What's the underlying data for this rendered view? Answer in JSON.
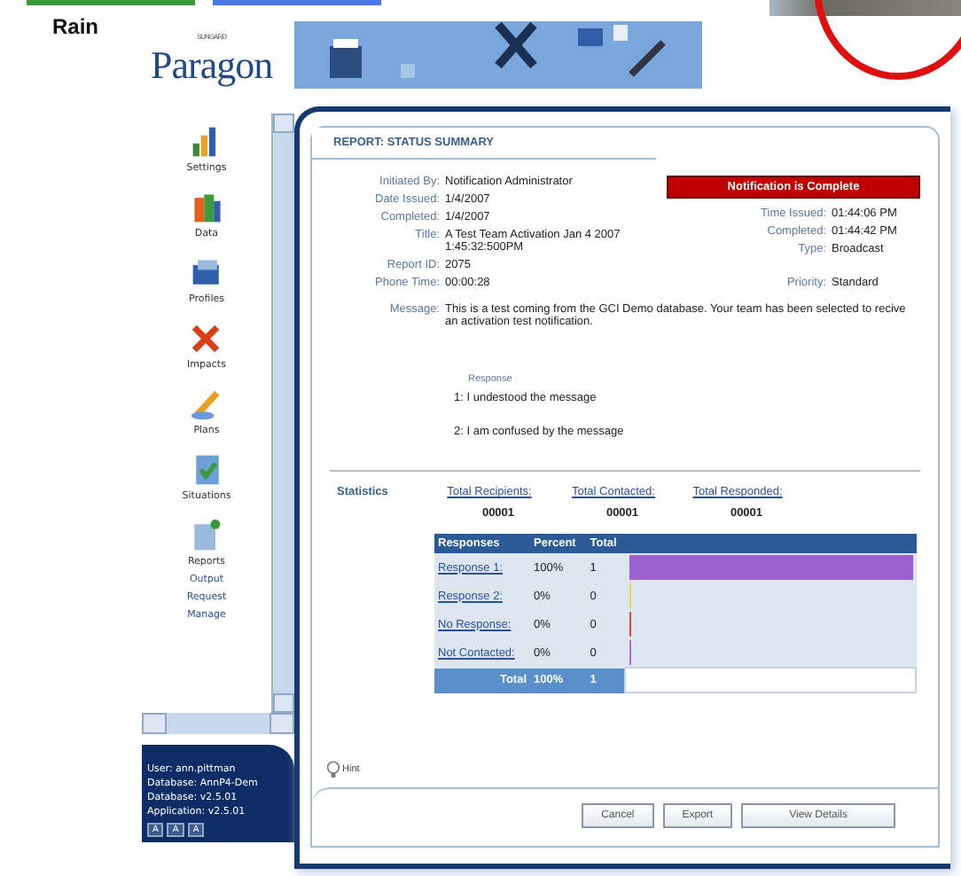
{
  "legend": [
    {
      "label": "Rain",
      "color": "#3a9a3a"
    },
    {
      "color": "#4a78e0"
    }
  ],
  "app": {
    "logo": "Paragon",
    "logo_tag": "SUNGARD"
  },
  "sidebar": {
    "items": [
      {
        "label": "Settings"
      },
      {
        "label": "Data"
      },
      {
        "label": "Profiles"
      },
      {
        "label": "Impacts"
      },
      {
        "label": "Plans"
      },
      {
        "label": "Situations"
      },
      {
        "label": "Reports",
        "children": [
          {
            "label": "Output"
          },
          {
            "label": "Request"
          },
          {
            "label": "Manage"
          }
        ]
      }
    ],
    "info": [
      "User: ann.pittman",
      "Database: AnnP4-Dem",
      "Database: v2.5.01",
      "Application: v2.5.01"
    ],
    "font_buttons": [
      "A",
      "A",
      "A"
    ]
  },
  "report": {
    "tab": "REPORT: STATUS SUMMARY",
    "status": "Notification is Complete",
    "left_fields": [
      {
        "label": "Initiated By:",
        "value": "Notification Administrator"
      },
      {
        "label": "Date Issued:",
        "value": "1/4/2007"
      },
      {
        "label": "Completed:",
        "value": "1/4/2007"
      },
      {
        "label": "Title:",
        "value": "A Test Team Activation Jan 4 2007 1:45:32:500PM"
      },
      {
        "label": "Report ID:",
        "value": "2075"
      },
      {
        "label": "Phone Time:",
        "value": "00:00:28"
      }
    ],
    "right_fields": [
      {
        "label": "Time Issued:",
        "value": "01:44:06 PM"
      },
      {
        "label": "Completed:",
        "value": "01:44:42 PM"
      },
      {
        "label": "Type:",
        "value": "Broadcast"
      },
      {
        "label": "Priority:",
        "value": "Standard"
      }
    ],
    "message_label": "Message:",
    "message": "This is a test coming from the GCI Demo database. Your team has been selected to recive an activation test notification.",
    "response_heading": "Response",
    "responses": [
      "1: I undestood the message",
      "2: I am confused by the message"
    ],
    "statistics_label": "Statistics",
    "statistics": [
      {
        "label": "Total Recipients:",
        "value": "00001"
      },
      {
        "label": "Total Contacted:",
        "value": "00001"
      },
      {
        "label": "Total Responded:",
        "value": "00001"
      }
    ],
    "table": {
      "columns": [
        "Responses",
        "Percent",
        "Total"
      ],
      "rows": [
        {
          "label": "Response 1:",
          "percent": "100%",
          "total": "1",
          "level": 1,
          "color": "#9b5fd0"
        },
        {
          "label": "Response 2:",
          "percent": "0%",
          "total": "0",
          "level": 0,
          "color": "#e8d84a"
        },
        {
          "label": "No Response:",
          "percent": "0%",
          "total": "0",
          "level": 0,
          "color": "#d94a4a"
        },
        {
          "label": "Not Contacted:",
          "percent": "0%",
          "total": "0",
          "level": 0,
          "color": "#b06ad8"
        }
      ],
      "total": {
        "label": "Total",
        "percent": "100%",
        "total": "1"
      }
    },
    "hint": "Hint",
    "buttons": [
      "Cancel",
      "Export",
      "View Details"
    ]
  }
}
